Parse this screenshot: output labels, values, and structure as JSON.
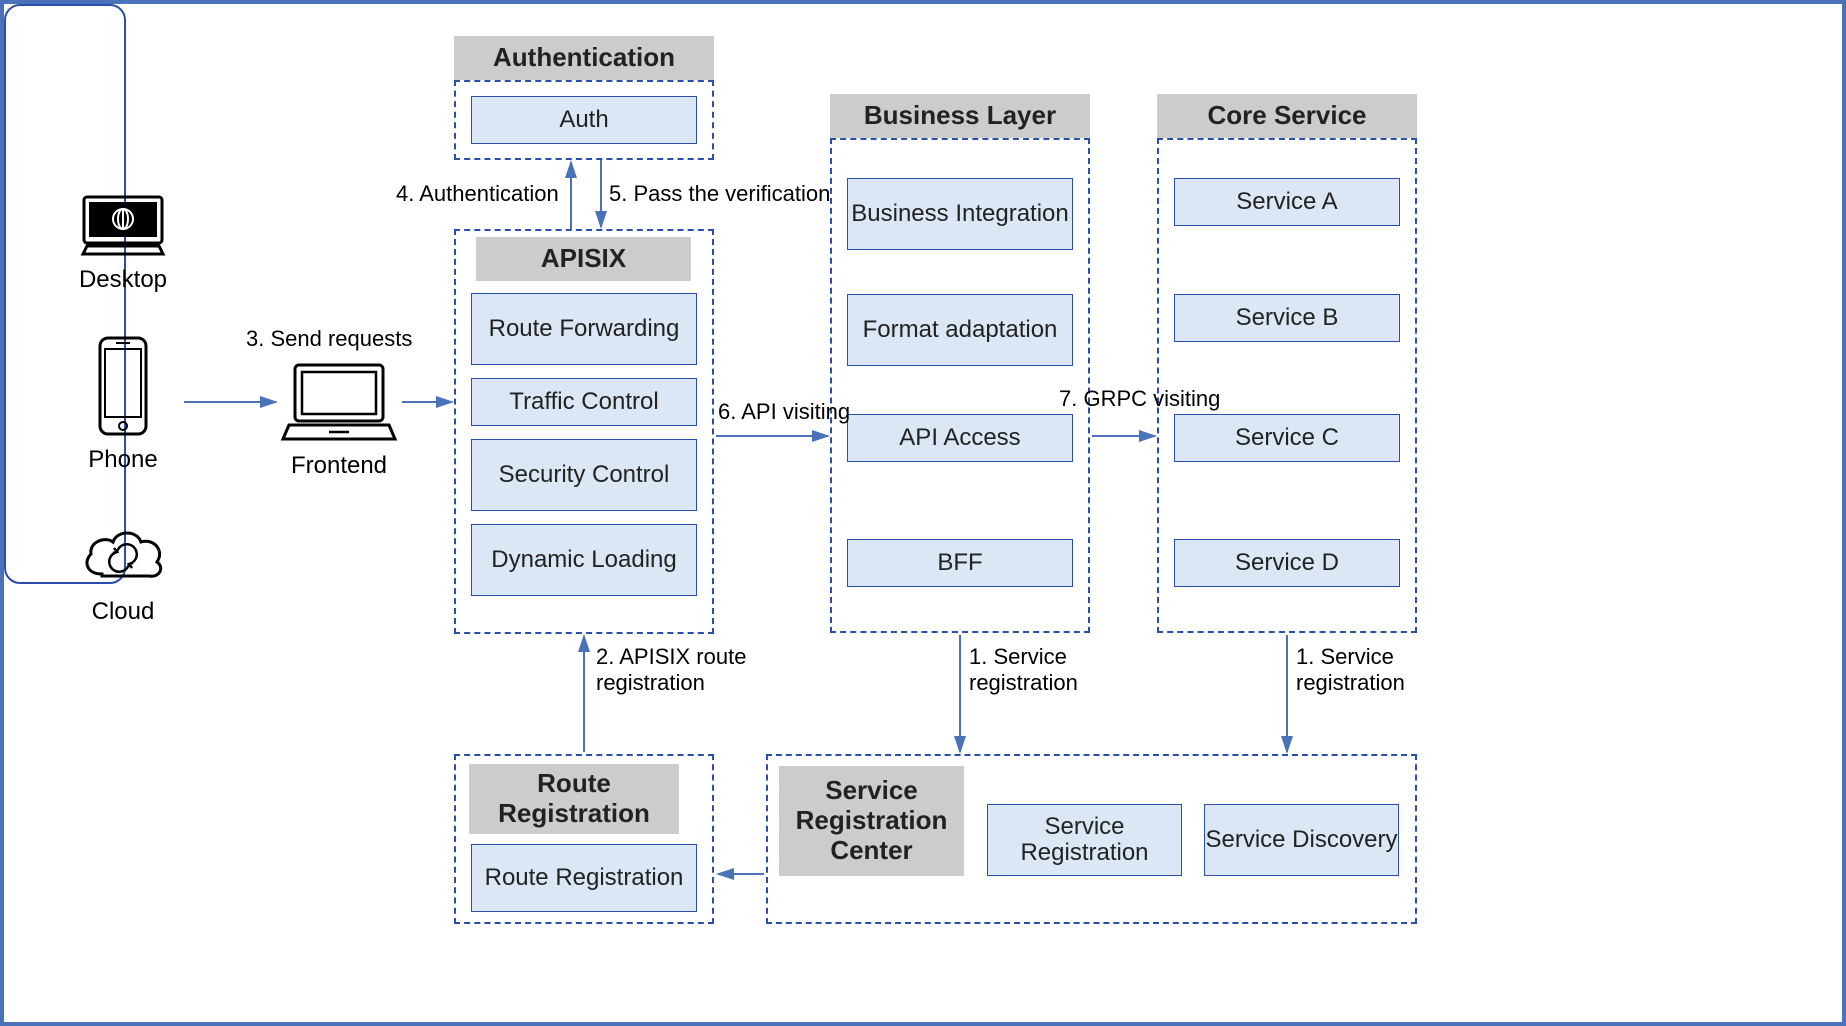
{
  "devices": {
    "desktop": "Desktop",
    "phone": "Phone",
    "cloud": "Cloud"
  },
  "frontend": {
    "label": "Frontend"
  },
  "auth": {
    "title": "Authentication",
    "box": "Auth"
  },
  "apisix": {
    "title": "APISIX",
    "items": [
      "Route Forwarding",
      "Traffic Control",
      "Security Control",
      "Dynamic Loading"
    ]
  },
  "business": {
    "title": "Business Layer",
    "items": [
      "Business Integration",
      "Format adaptation",
      "API Access",
      "BFF"
    ]
  },
  "core": {
    "title": "Core Service",
    "items": [
      "Service A",
      "Service B",
      "Service C",
      "Service D"
    ]
  },
  "routeReg": {
    "title": "Route Registration",
    "box": "Route Registration"
  },
  "svcCenter": {
    "title": "Service Registration Center",
    "boxes": [
      "Service Registration",
      "Service Discovery"
    ]
  },
  "edges": {
    "e1a": "1. Service registration",
    "e1b": "1. Service registration",
    "e2": "2. APISIX route registration",
    "e3": "3. Send requests",
    "e4": "4. Authentication",
    "e5": "5. Pass the verification",
    "e6": "6. API visiting",
    "e7": "7. GRPC visiting"
  }
}
